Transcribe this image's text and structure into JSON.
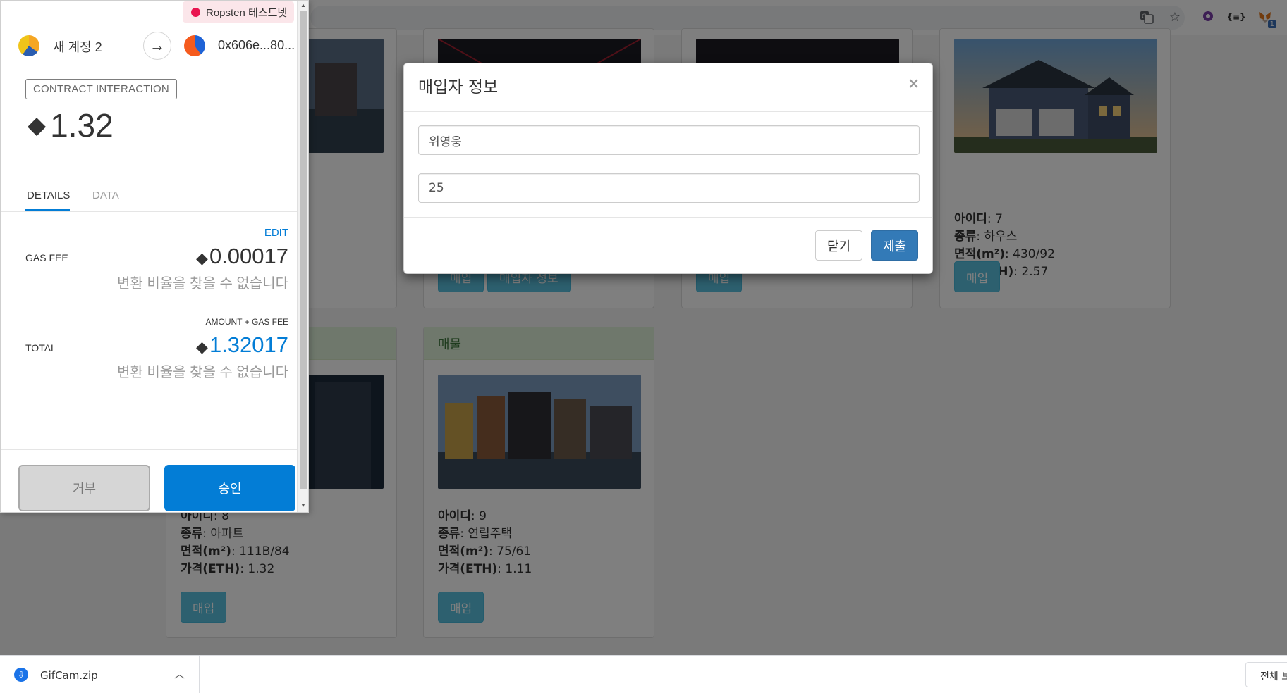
{
  "metamask": {
    "network": "Ropsten 테스트넷",
    "from_account": "새 계정 2",
    "to_address": "0x606e...80...",
    "interaction_badge": "CONTRACT INTERACTION",
    "eth_symbol": "◆",
    "amount": "1.32",
    "tabs": {
      "details": "DETAILS",
      "data": "DATA"
    },
    "edit": "EDIT",
    "gas_fee_label": "GAS FEE",
    "gas_fee_value": "0.00017",
    "conversion_unavailable": "변환 비율을 찾을 수 없습니다",
    "amount_gas_label": "AMOUNT + GAS FEE",
    "total_label": "TOTAL",
    "total_value": "1.32017",
    "reject": "거부",
    "approve": "승인"
  },
  "modal": {
    "title": "매입자 정보",
    "close_x": "×",
    "buyer_name": "위영웅",
    "buyer_age": "25",
    "close_button": "닫기",
    "submit_button": "제출"
  },
  "listings": [
    {
      "header": "매물",
      "id_label": "아이디",
      "id": "9",
      "type_label": "종류",
      "type": "연립주택",
      "area_label": "면적(m²)",
      "area": "75/61",
      "price_label": "가격(ETH)",
      "price": "1.11",
      "buy": "매입"
    },
    {
      "id_label": "아이디",
      "id": "8",
      "type_label": "종류",
      "type": "아파트",
      "area_label": "면적(m²)",
      "area": "111B/84",
      "price_label": "가격(ETH)",
      "price": "1.32",
      "buy": "매입"
    },
    {
      "id_label": "아이디",
      "id": "7",
      "type_label": "종류",
      "type": "하우스",
      "area_label": "면적(m²)",
      "area": "430/92",
      "price_label": "가격(ETH)",
      "price": "2.57",
      "buy": "매입"
    }
  ],
  "partial_buttons": {
    "buyer_info": "매입자 정보",
    "buy": "매입"
  },
  "extension_badge": "1",
  "download": {
    "filename": "GifCam.zip",
    "show_all": "전체 보"
  }
}
